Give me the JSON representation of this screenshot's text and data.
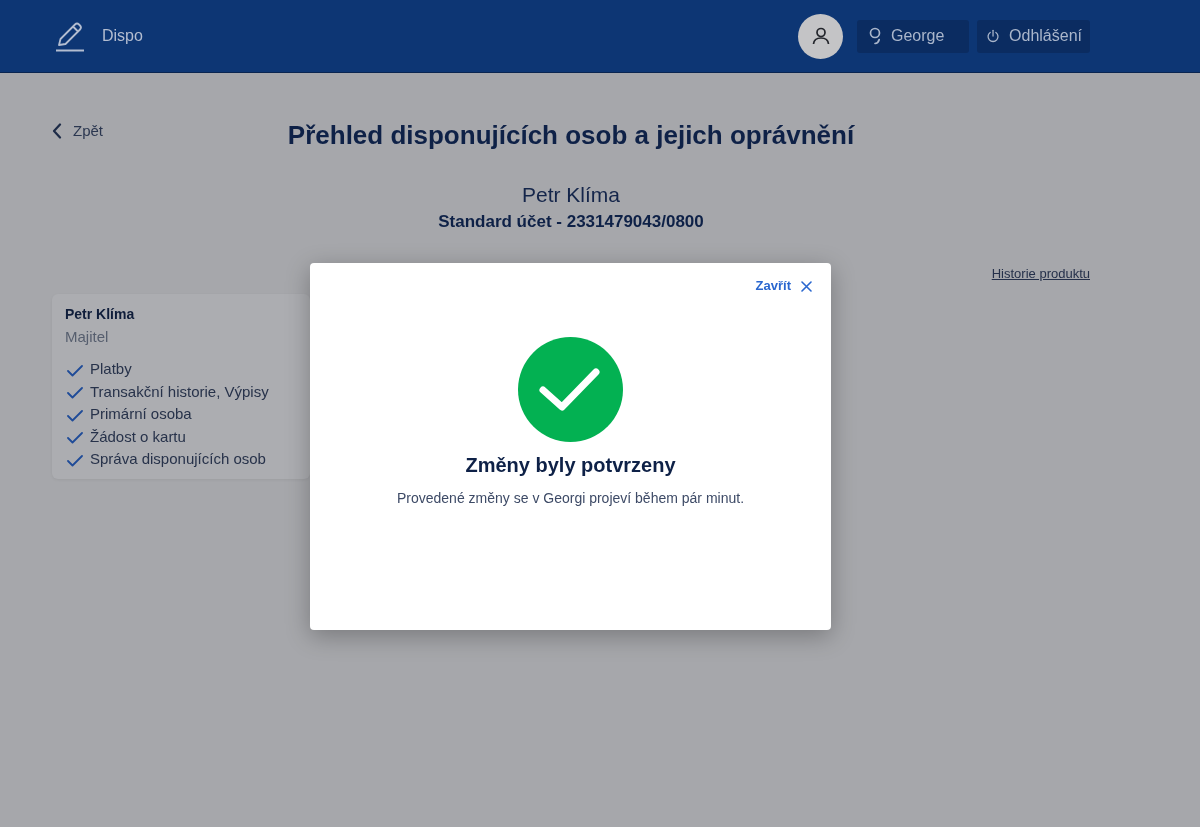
{
  "header": {
    "app_name": "Dispo",
    "user_button": "George",
    "logout_button": "Odhlášení"
  },
  "back_link": "Zpět",
  "title": "Přehled disponujících osob a jejich oprávnění",
  "account": {
    "owner": "Petr Klíma",
    "product": "Standard účet - 2331479043/0800"
  },
  "history_link": "Historie produktu",
  "persons": [
    {
      "name": "Petr Klíma",
      "role": "Majitel",
      "permissions": [
        {
          "label": "Platby",
          "granted": true
        },
        {
          "label": "Transakční historie, Výpisy",
          "granted": true
        },
        {
          "label": "Primární osoba",
          "granted": true
        },
        {
          "label": "Žádost o kartu",
          "granted": true
        },
        {
          "label": "Správa disponujících osob",
          "granted": true
        }
      ]
    }
  ],
  "dialog": {
    "kind": "success",
    "close_label": "Zavřít",
    "title": "Změny byly potvrzeny",
    "message": "Provedené změny se v Georgi projeví během pár minut."
  }
}
